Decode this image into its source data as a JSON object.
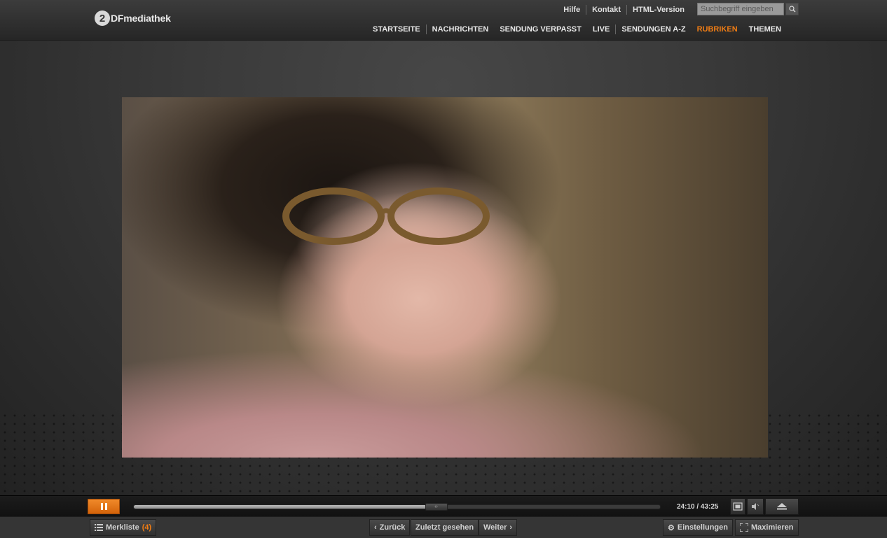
{
  "header": {
    "logo_mark": "2",
    "logo_text": "DFmediathek",
    "util_links": [
      "Hilfe",
      "Kontakt",
      "HTML-Version"
    ],
    "search_placeholder": "Suchbegriff eingeben",
    "nav": [
      {
        "label": "STARTSEITE",
        "active": false
      },
      {
        "label": "NACHRICHTEN",
        "active": false
      },
      {
        "label": "SENDUNG VERPASST",
        "active": false
      },
      {
        "label": "LIVE",
        "active": false
      },
      {
        "label": "SENDUNGEN A-Z",
        "active": false
      },
      {
        "label": "RUBRIKEN",
        "active": true
      },
      {
        "label": "THEMEN",
        "active": false
      }
    ]
  },
  "player": {
    "time": "24:10 / 43:25",
    "progress_fraction": 0.556,
    "state": "playing",
    "accent_color": "#f07d14"
  },
  "bottombar": {
    "merkliste_label": "Merkliste",
    "merkliste_count": "(4)",
    "zurueck_label": "Zurück",
    "zuletzt_label": "Zuletzt gesehen",
    "weiter_label": "Weiter",
    "einstellungen_label": "Einstellungen",
    "maximieren_label": "Maximieren"
  }
}
